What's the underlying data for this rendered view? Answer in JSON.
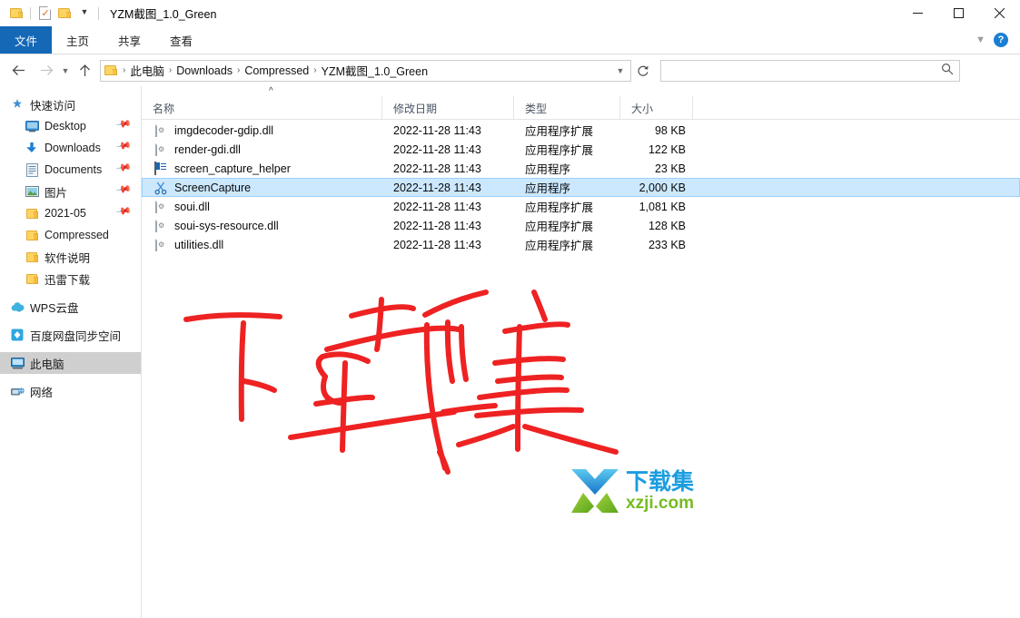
{
  "window": {
    "title": "YZM截图_1.0_Green",
    "quick_access": [
      {
        "name": "folder-icon",
        "label": "文件夹"
      },
      {
        "name": "properties-icon",
        "label": "属性"
      },
      {
        "name": "new-folder-icon",
        "label": "新建文件夹"
      },
      {
        "name": "customize-dropdown-icon",
        "label": "自定义快速访问工具栏"
      }
    ],
    "controls": {
      "minimize": "最小化",
      "maximize": "最大化",
      "close": "关闭"
    }
  },
  "ribbon": {
    "tabs": [
      {
        "label": "文件",
        "active": true
      },
      {
        "label": "主页",
        "active": false
      },
      {
        "label": "共享",
        "active": false
      },
      {
        "label": "查看",
        "active": false
      }
    ],
    "collapse_icon": "chevron-down-icon",
    "help_label": "?"
  },
  "nav": {
    "back_icon": "arrow-left-icon",
    "forward_icon": "arrow-right-icon",
    "recent_icon": "chevron-down-icon",
    "up_icon": "arrow-up-icon",
    "refresh_icon": "refresh-icon",
    "breadcrumbs": [
      "此电脑",
      "Downloads",
      "Compressed",
      "YZM截图_1.0_Green"
    ],
    "separator": "›"
  },
  "search": {
    "value": "",
    "placeholder": "",
    "icon": "search-icon"
  },
  "sidebar": {
    "items": [
      {
        "label": "快速访问",
        "icon": "quick-access-star-icon",
        "level": 0,
        "pinned": false,
        "selected": false
      },
      {
        "label": "Desktop",
        "icon": "desktop-icon",
        "level": 1,
        "pinned": true,
        "selected": false
      },
      {
        "label": "Downloads",
        "icon": "downloads-icon",
        "level": 1,
        "pinned": true,
        "selected": false
      },
      {
        "label": "Documents",
        "icon": "documents-icon",
        "level": 1,
        "pinned": true,
        "selected": false
      },
      {
        "label": "图片",
        "icon": "pictures-icon",
        "level": 1,
        "pinned": true,
        "selected": false
      },
      {
        "label": "2021-05",
        "icon": "folder-icon",
        "level": 1,
        "pinned": true,
        "selected": false
      },
      {
        "label": "Compressed",
        "icon": "folder-icon",
        "level": 1,
        "pinned": false,
        "selected": false
      },
      {
        "label": "软件说明",
        "icon": "folder-icon",
        "level": 1,
        "pinned": false,
        "selected": false
      },
      {
        "label": "迅雷下载",
        "icon": "folder-icon",
        "level": 1,
        "pinned": false,
        "selected": false
      },
      {
        "label": "WPS云盘",
        "icon": "wps-cloud-icon",
        "level": 0,
        "pinned": false,
        "selected": false,
        "gap_before": true
      },
      {
        "label": "百度网盘同步空间",
        "icon": "baidu-netdisk-icon",
        "level": 0,
        "pinned": false,
        "selected": false,
        "gap_before": true
      },
      {
        "label": "此电脑",
        "icon": "this-pc-icon",
        "level": 0,
        "pinned": false,
        "selected": true,
        "gap_before": true
      },
      {
        "label": "网络",
        "icon": "network-icon",
        "level": 0,
        "pinned": false,
        "selected": false,
        "gap_before": true
      }
    ]
  },
  "filelist": {
    "sort_indicator": "ascending-caret-icon",
    "columns": [
      {
        "label": "名称"
      },
      {
        "label": "修改日期"
      },
      {
        "label": "类型"
      },
      {
        "label": "大小"
      }
    ],
    "rows": [
      {
        "name": "imgdecoder-gdip.dll",
        "date": "2022-11-28 11:43",
        "type": "应用程序扩展",
        "size": "98 KB",
        "icon": "dll-file-icon",
        "selected": false
      },
      {
        "name": "render-gdi.dll",
        "date": "2022-11-28 11:43",
        "type": "应用程序扩展",
        "size": "122 KB",
        "icon": "dll-file-icon",
        "selected": false
      },
      {
        "name": "screen_capture_helper",
        "date": "2022-11-28 11:43",
        "type": "应用程序",
        "size": "23 KB",
        "icon": "application-icon",
        "selected": false
      },
      {
        "name": "ScreenCapture",
        "date": "2022-11-28 11:43",
        "type": "应用程序",
        "size": "2,000 KB",
        "icon": "scissors-application-icon",
        "selected": true
      },
      {
        "name": "soui.dll",
        "date": "2022-11-28 11:43",
        "type": "应用程序扩展",
        "size": "1,081 KB",
        "icon": "dll-file-icon",
        "selected": false
      },
      {
        "name": "soui-sys-resource.dll",
        "date": "2022-11-28 11:43",
        "type": "应用程序扩展",
        "size": "128 KB",
        "icon": "dll-file-icon",
        "selected": false
      },
      {
        "name": "utilities.dll",
        "date": "2022-11-28 11:43",
        "type": "应用程序扩展",
        "size": "233 KB",
        "icon": "dll-file-icon",
        "selected": false
      }
    ]
  },
  "annotation": {
    "text": "下载集",
    "color": "#ee2222",
    "style": "handwritten-red-ink"
  },
  "watermark": {
    "logo_icon": "download-arrow-logo",
    "cn_text": "下载集",
    "en_text": "xzji.com",
    "cn_color": "#1b9de0",
    "en_color": "#76bc21"
  }
}
